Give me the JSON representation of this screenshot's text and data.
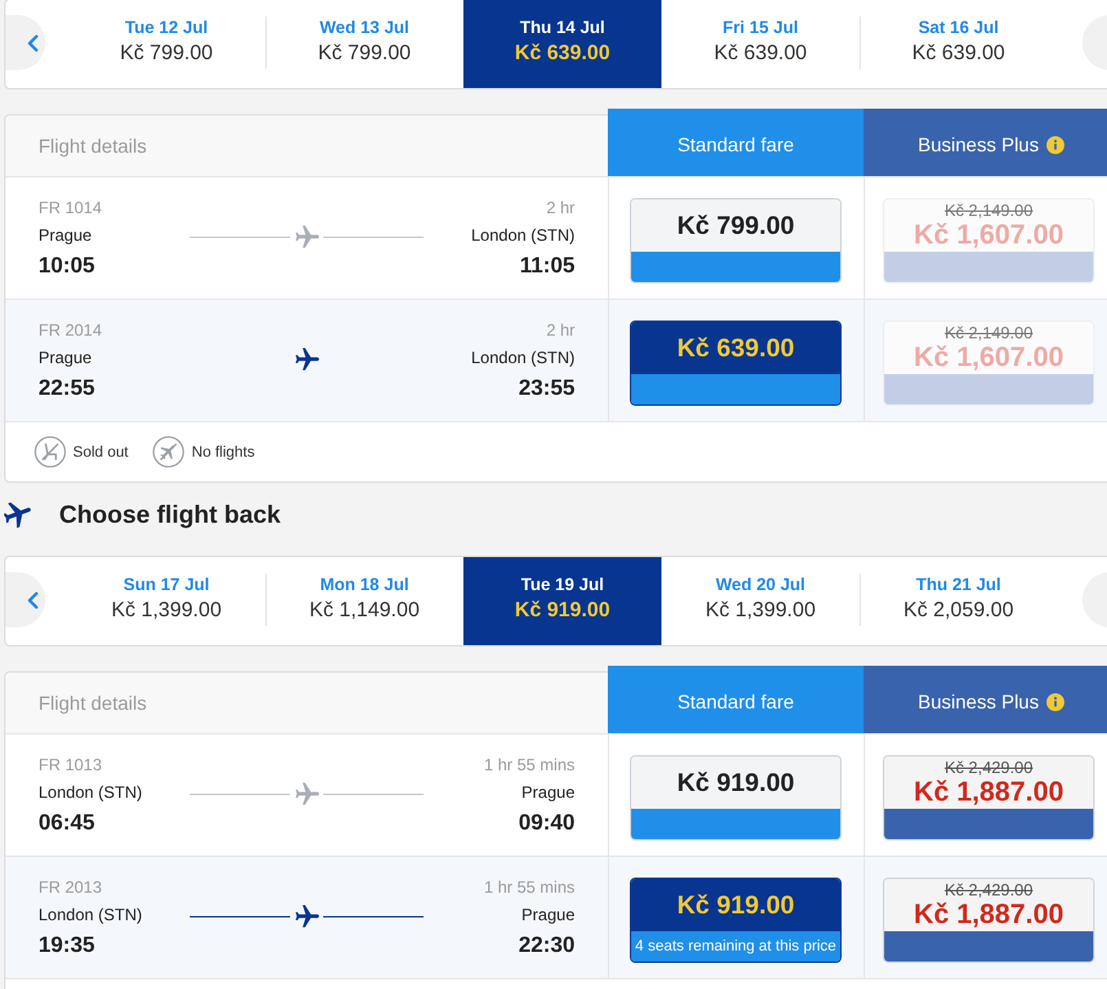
{
  "outbound": {
    "dates": [
      {
        "date": "Tue 12 Jul",
        "price": "Kč 799.00",
        "selected": false
      },
      {
        "date": "Wed 13 Jul",
        "price": "Kč 799.00",
        "selected": false
      },
      {
        "date": "Thu 14 Jul",
        "price": "Kč 639.00",
        "selected": true
      },
      {
        "date": "Fri 15 Jul",
        "price": "Kč 639.00",
        "selected": false
      },
      {
        "date": "Sat 16 Jul",
        "price": "Kč 639.00",
        "selected": false
      }
    ],
    "fares": {
      "columns": {
        "details": "Flight details",
        "standard": "Standard fare",
        "business": "Business Plus"
      },
      "flights": [
        {
          "flight_number": "FR 1014",
          "duration": "2 hr",
          "origin": "Prague",
          "destination": "London (STN)",
          "departure": "10:05",
          "arrival": "11:05",
          "selected": false,
          "route_line": true,
          "standard_fare": {
            "price": "Kč 799.00"
          },
          "business_plus": {
            "old_price": "Kč 2,149.00",
            "price": "Kč 1,607.00",
            "disabled": true
          }
        },
        {
          "flight_number": "FR 2014",
          "duration": "2 hr",
          "origin": "Prague",
          "destination": "London (STN)",
          "departure": "22:55",
          "arrival": "23:55",
          "selected": true,
          "route_line": false,
          "standard_fare": {
            "price": "Kč 639.00"
          },
          "business_plus": {
            "old_price": "Kč 2,149.00",
            "price": "Kč 1,607.00",
            "disabled": true
          }
        }
      ],
      "legend": [
        {
          "kind": "sold_out",
          "label": "Sold out"
        },
        {
          "kind": "no_flights",
          "label": "No flights"
        }
      ]
    }
  },
  "return": {
    "title": "Choose flight back",
    "dates": [
      {
        "date": "Sun 17 Jul",
        "price": "Kč 1,399.00",
        "selected": false
      },
      {
        "date": "Mon 18 Jul",
        "price": "Kč 1,149.00",
        "selected": false
      },
      {
        "date": "Tue 19 Jul",
        "price": "Kč 919.00",
        "selected": true
      },
      {
        "date": "Wed 20 Jul",
        "price": "Kč 1,399.00",
        "selected": false
      },
      {
        "date": "Thu 21 Jul",
        "price": "Kč 2,059.00",
        "selected": false
      }
    ],
    "fares": {
      "columns": {
        "details": "Flight details",
        "standard": "Standard fare",
        "business": "Business Plus"
      },
      "flights": [
        {
          "flight_number": "FR 1013",
          "duration": "1 hr 55 mins",
          "origin": "London (STN)",
          "destination": "Prague",
          "departure": "06:45",
          "arrival": "09:40",
          "selected": false,
          "route_line": true,
          "standard_fare": {
            "price": "Kč 919.00"
          },
          "business_plus": {
            "old_price": "Kč 2,429.00",
            "price": "Kč 1,887.00",
            "disabled": false
          }
        },
        {
          "flight_number": "FR 2013",
          "duration": "1 hr 55 mins",
          "origin": "London (STN)",
          "destination": "Prague",
          "departure": "19:35",
          "arrival": "22:30",
          "selected": true,
          "route_line": true,
          "standard_fare": {
            "price": "Kč 919.00",
            "note": "4 seats remaining at this price"
          },
          "business_plus": {
            "old_price": "Kč 2,429.00",
            "price": "Kč 1,887.00",
            "disabled": false
          }
        }
      ]
    }
  }
}
